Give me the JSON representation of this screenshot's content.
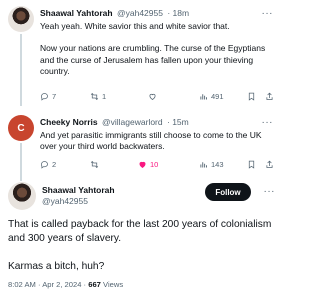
{
  "tweets": [
    {
      "author": "Shaawal Yahtorah",
      "handle": "@yah42955",
      "time": "· 18m",
      "text": "Yeah yeah. White savior this and white savior that.\n\nNow your nations are crumbling. The curse of the Egyptians and the curse of Jerusalem has fallen upon your thieving country.",
      "replies": "7",
      "retweets": "1",
      "likes": "",
      "views": "491"
    },
    {
      "author": "Cheeky Norris",
      "handle": "@villagewarlord",
      "time": "· 15m",
      "avatar_letter": "C",
      "text": "And yet parasitic immigrants still choose to come to the UK over your third world backwaters.",
      "replies": "2",
      "retweets": "",
      "likes": "10",
      "views": "143"
    }
  ],
  "main_tweet": {
    "author": "Shaawal Yahtorah",
    "handle": "@yah42955",
    "follow_label": "Follow",
    "text": "That is called payback for the last 200 years of colonialism and 300 years of slavery.\n\nKarmas a bitch, huh?",
    "timestamp": "8:02 AM · Apr 2, 2024 ·",
    "views_count": "667",
    "views_label": "Views"
  },
  "icons": [
    "reply-icon",
    "retweet-icon",
    "like-icon",
    "views-icon",
    "bookmark-icon",
    "share-icon",
    "more-icon"
  ],
  "colors": {
    "like_active": "#f91880",
    "muted": "#536471",
    "follow_bg": "#0f1419"
  }
}
